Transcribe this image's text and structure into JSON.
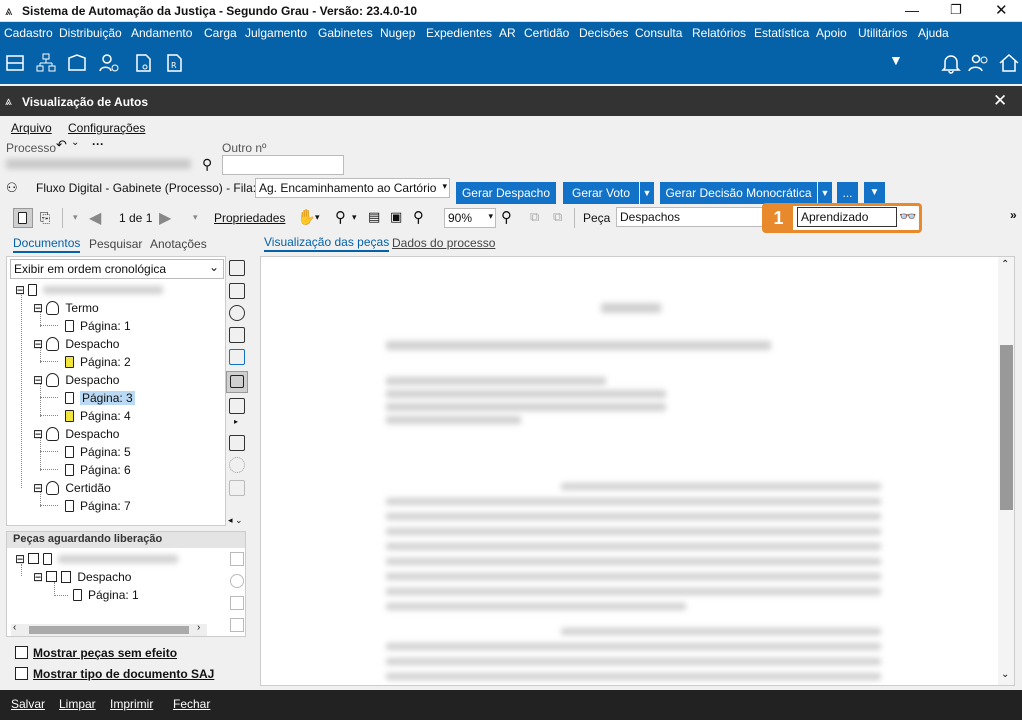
{
  "window": {
    "title": "Sistema de Automação da Justiça - Segundo Grau - Versão: 23.4.0-10"
  },
  "menu": [
    "Cadastro",
    "Distribuição",
    "Andamento",
    "Carga",
    "Julgamento",
    "Gabinetes",
    "Nugep",
    "Expedientes",
    "AR",
    "Certidão",
    "Decisões",
    "Consulta",
    "Relatórios",
    "Estatística",
    "Apoio",
    "Utilitários",
    "Ajuda"
  ],
  "subwindow": {
    "title": "Visualização de Autos"
  },
  "filemenu": {
    "arquivo": "Arquivo",
    "config": "Configurações"
  },
  "processo": {
    "label": "Processo",
    "outro_label": "Outro nº"
  },
  "fluxo": {
    "label": "Fluxo Digital - Gabinete (Processo) - Fila:",
    "fila": "Ag. Encaminhamento ao Cartório"
  },
  "buttons": {
    "despacho": "Gerar Despacho",
    "voto": "Gerar Voto",
    "decisao": "Gerar Decisão Monocrática",
    "more": "..."
  },
  "toolbar": {
    "page": "1 de 1",
    "propriedades": "Propriedades",
    "zoom": "90%",
    "peca_label": "Peça",
    "peca_value": "Despachos",
    "search_value": "Aprendizado",
    "badge": "1"
  },
  "lefttabs": {
    "documentos": "Documentos",
    "pesquisar": "Pesquisar",
    "anotacoes": "Anotações"
  },
  "viewtabs": {
    "visualizacao": "Visualização das peças",
    "dados": "Dados do processo"
  },
  "order": "Exibir em ordem cronológica",
  "tree": {
    "termo": "Termo",
    "despacho": "Despacho",
    "certidao": "Certidão",
    "p1": "Página: 1",
    "p2": "Página: 2",
    "p3": "Página: 3",
    "p4": "Página: 4",
    "p5": "Página: 5",
    "p6": "Página: 6",
    "p7": "Página: 7"
  },
  "pending": {
    "title": "Peças aguardando liberação",
    "despacho": "Despacho",
    "p1": "Página: 1"
  },
  "checks": {
    "semefeito": "Mostrar peças sem efeito",
    "tipo": "Mostrar tipo de documento SAJ"
  },
  "bottom": {
    "salvar": "Salvar",
    "limpar": "Limpar",
    "imprimir": "Imprimir",
    "fechar": "Fechar"
  },
  "colors": {
    "accent": "#0561a8",
    "button": "#1172c7",
    "highlight": "#e8892c"
  }
}
